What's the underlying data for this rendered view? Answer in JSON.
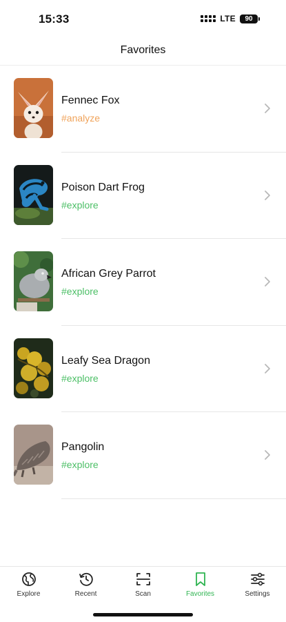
{
  "status_bar": {
    "time": "15:33",
    "network": "LTE",
    "battery": "90"
  },
  "nav": {
    "title": "Favorites"
  },
  "favorites": [
    {
      "name": "Fennec Fox",
      "tag": "#analyze",
      "tag_color": "#f0a35a"
    },
    {
      "name": "Poison Dart Frog",
      "tag": "#explore",
      "tag_color": "#4cbf66"
    },
    {
      "name": "African Grey Parrot",
      "tag": "#explore",
      "tag_color": "#4cbf66"
    },
    {
      "name": "Leafy Sea Dragon",
      "tag": "#explore",
      "tag_color": "#4cbf66"
    },
    {
      "name": "Pangolin",
      "tag": "#explore",
      "tag_color": "#4cbf66"
    }
  ],
  "tab_bar": {
    "tabs": [
      {
        "label": "Explore",
        "icon": "globe-icon"
      },
      {
        "label": "Recent",
        "icon": "history-icon"
      },
      {
        "label": "Scan",
        "icon": "scan-icon"
      },
      {
        "label": "Favorites",
        "icon": "bookmark-icon",
        "active": true
      },
      {
        "label": "Settings",
        "icon": "sliders-icon"
      }
    ],
    "active_color": "#2fb451"
  }
}
